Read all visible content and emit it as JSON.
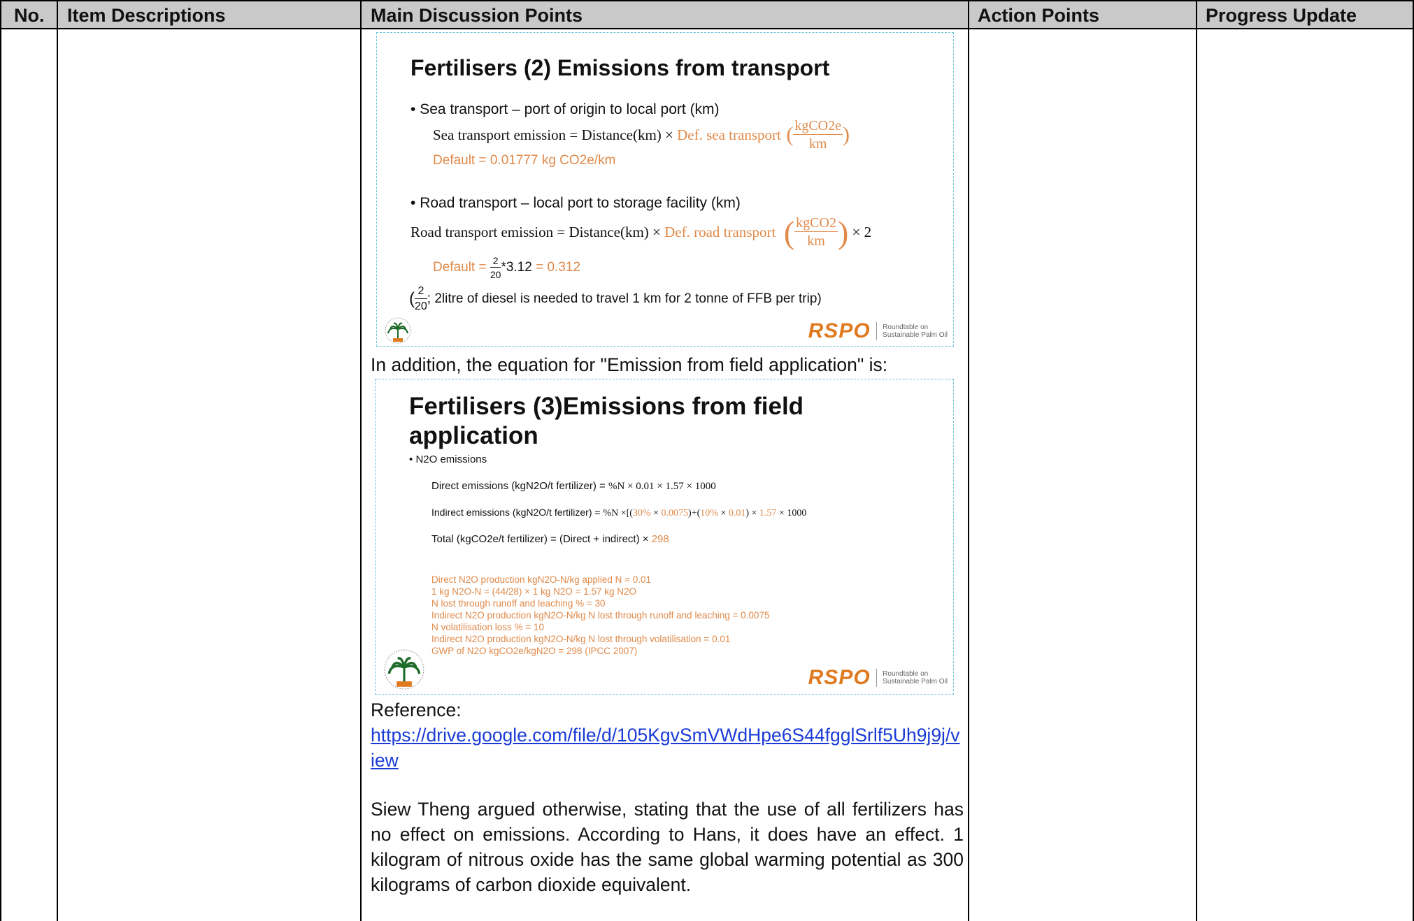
{
  "table": {
    "headers": {
      "no": "No.",
      "items": "Item Descriptions",
      "discussion": "Main Discussion Points",
      "actions": "Action Points",
      "progress": "Progress Update"
    }
  },
  "slide1": {
    "title": "Fertilisers (2) Emissions from transport",
    "bullet1": "Sea transport – port of origin to local port (km)",
    "sea_formula_lhs": "Sea transport emission = Distance(km) ×",
    "sea_formula_def": "Def. sea transport",
    "unit_num": "kgCO2e",
    "unit_den": "km",
    "sea_default": "Default = 0.01777 kg CO2e/km",
    "bullet2": "Road transport – local port to storage facility (km)",
    "road_formula_lhs": "Road transport emission = Distance(km) ×",
    "road_formula_def": "Def. road transport",
    "road_unit_num": "kgCO2",
    "road_unit_den": "km",
    "road_times": "× 2",
    "road_default_label": "Default =",
    "road_default_frac_num": "2",
    "road_default_frac_den": "20",
    "road_default_mult": "*3.12",
    "road_default_result": "= 0.312",
    "note_frac_num": "2",
    "note_frac_den": "20",
    "note_text": "; 2litre of diesel is needed to travel 1 km for 2 tonne of FFB per trip)",
    "logo_word": "RSPO",
    "logo_tag_1": "Roundtable on",
    "logo_tag_2": "Sustainable Palm Oil"
  },
  "para_intro": "In addition, the equation for \"Emission from field application\" is:",
  "slide2": {
    "title_line1": "Fertilisers (3)Emissions from field",
    "title_line2": "application",
    "bullet": "N2O emissions",
    "direct_label": "Direct emissions (kgN2O/t fertilizer) =",
    "direct_formula": "%N × 0.01 × 1.57 × 1000",
    "indirect_label": "Indirect emissions (kgN2O/t fertilizer) =",
    "indirect_p1": "%N ×[(",
    "indirect_o1": "30%",
    "indirect_p2": " × ",
    "indirect_o2": "0.0075",
    "indirect_p3": ")+(",
    "indirect_o3": "10%",
    "indirect_p4": " × ",
    "indirect_o4": "0.01",
    "indirect_p5": ") × ",
    "indirect_o5": "1.57",
    "indirect_p6": " × 1000",
    "total_label": "Total (kgCO2e/t fertilizer) = (Direct + indirect) ×",
    "total_value": "298",
    "notes": [
      "Direct N2O production kgN2O-N/kg applied N = 0.01",
      "1 kg N2O-N = (44/28) × 1 kg N2O = 1.57 kg N2O",
      "N lost through runoff and leaching % = 30",
      "Indirect N2O production kgN2O-N/kg N lost through runoff and leaching = 0.0075",
      "N volatilisation loss % = 10",
      "Indirect N2O production kgN2O-N/kg N lost through volatilisation = 0.01",
      "GWP of N2O kgCO2e/kgN2O = 298 (IPCC 2007)"
    ],
    "logo_word": "RSPO",
    "logo_tag_1": "Roundtable on",
    "logo_tag_2": "Sustainable Palm Oil"
  },
  "reference_label": "Reference:",
  "reference_link": "https://drive.google.com/file/d/105KgvSmVWdHpe6S44fgglSrlf5Uh9j9j/view",
  "para_final": "Siew Theng argued otherwise, stating that the use of all fertilizers has no effect on emissions.  According to Hans, it does have an effect.  1 kilogram of nitrous oxide has the same global warming potential as 300 kilograms of carbon dioxide equivalent.",
  "colors": {
    "header_bg": "#c9c9c9",
    "accent_orange": "#e08a4a",
    "link": "#1a3bd6",
    "slide_border": "#6ec3da"
  }
}
